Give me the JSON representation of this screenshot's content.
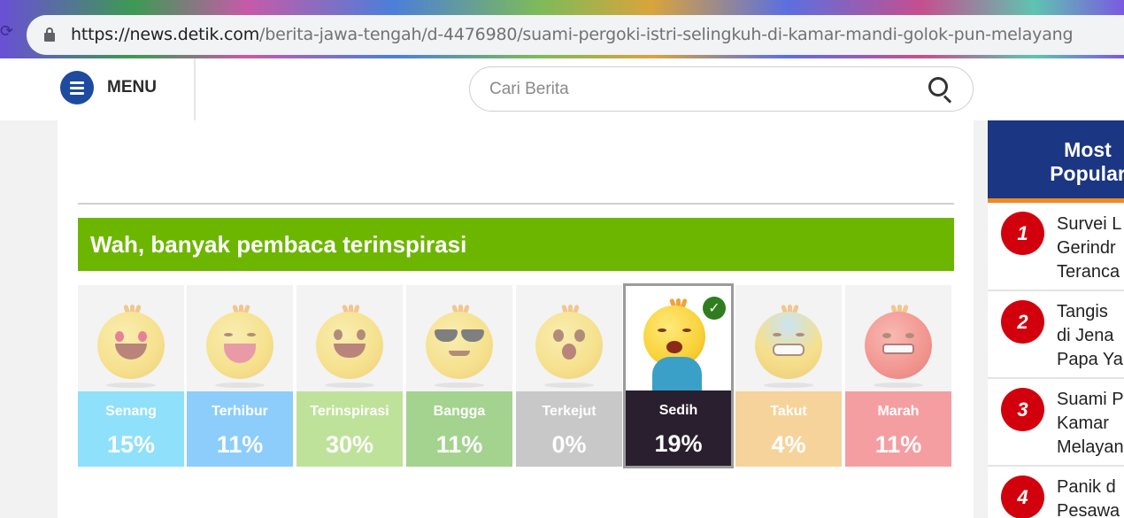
{
  "browser": {
    "url_host": "https://news.detik.com",
    "url_path": "/berita-jawa-tengah/d-4476980/suami-pergoki-istri-selingkuh-di-kamar-mandi-golok-pun-melayang"
  },
  "header": {
    "menu_label": "MENU",
    "search_placeholder": "Cari Berita"
  },
  "reaction_block": {
    "banner_text": "Wah, banyak pembaca terinspirasi",
    "banner_color": "#6db600",
    "selected": "Sedih",
    "reactions": [
      {
        "name": "Senang",
        "percent": "15%",
        "color": "#8fe0fb"
      },
      {
        "name": "Terhibur",
        "percent": "11%",
        "color": "#8ccdfb"
      },
      {
        "name": "Terinspirasi",
        "percent": "30%",
        "color": "#bfe29a"
      },
      {
        "name": "Bangga",
        "percent": "11%",
        "color": "#a3d38f"
      },
      {
        "name": "Terkejut",
        "percent": "0%",
        "color": "#c8c8c8"
      },
      {
        "name": "Sedih",
        "percent": "19%",
        "color": "#2a1f2e"
      },
      {
        "name": "Takut",
        "percent": "4%",
        "color": "#f6d39a"
      },
      {
        "name": "Marah",
        "percent": "11%",
        "color": "#f59ea1"
      }
    ]
  },
  "sidebar": {
    "title_line1": "Most",
    "title_line2": "Popular",
    "items": [
      {
        "rank": "1",
        "lines": [
          "Survei L",
          "Gerindr",
          "Teranca"
        ]
      },
      {
        "rank": "2",
        "lines": [
          "Tangis",
          "di Jena",
          "Papa Ya"
        ]
      },
      {
        "rank": "3",
        "lines": [
          "Suami P",
          "Kamar",
          "Melayan"
        ]
      },
      {
        "rank": "4",
        "lines": [
          "Panik d",
          "Pesawa"
        ]
      }
    ]
  }
}
